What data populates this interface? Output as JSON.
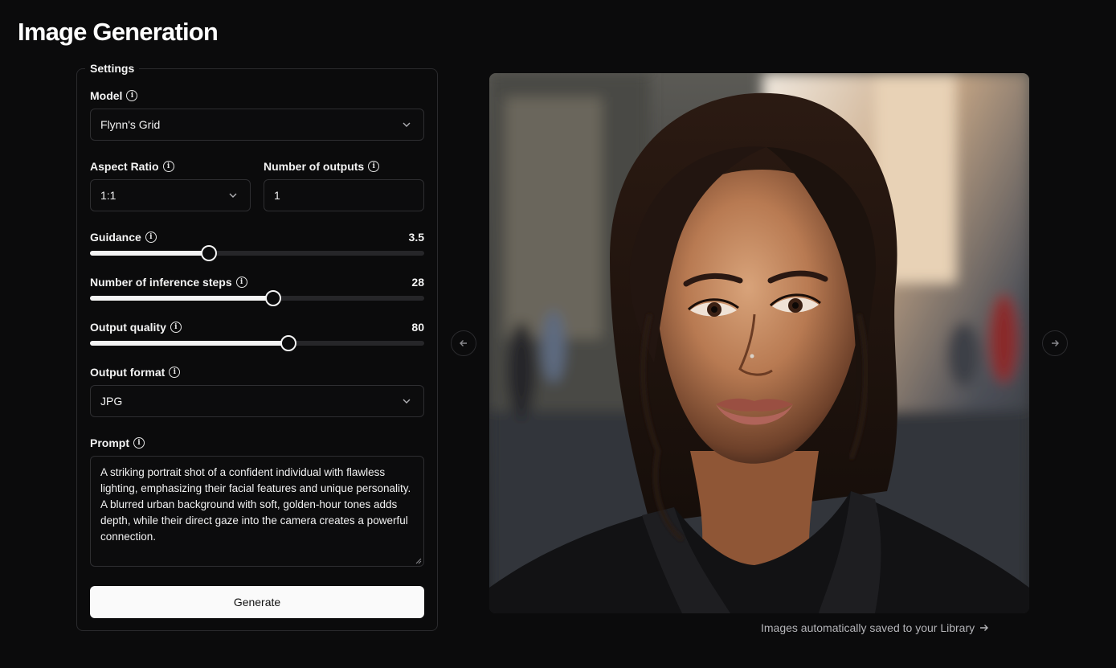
{
  "page": {
    "title": "Image Generation"
  },
  "settings": {
    "legend": "Settings",
    "model": {
      "label": "Model",
      "value": "Flynn's Grid"
    },
    "aspect_ratio": {
      "label": "Aspect Ratio",
      "value": "1:1"
    },
    "num_outputs": {
      "label": "Number of outputs",
      "value": "1"
    },
    "guidance": {
      "label": "Guidance",
      "value": "3.5",
      "fraction": 0.355
    },
    "inference_steps": {
      "label": "Number of inference steps",
      "value": "28",
      "fraction": 0.548
    },
    "output_quality": {
      "label": "Output quality",
      "value": "80",
      "fraction": 0.593
    },
    "output_format": {
      "label": "Output format",
      "value": "JPG"
    },
    "prompt": {
      "label": "Prompt",
      "value": "A striking portrait shot of a confident individual with flawless lighting, emphasizing their facial features and unique personality. A blurred urban background with soft, golden-hour tones adds depth, while their direct gaze into the camera creates a powerful connection."
    },
    "generate_label": "Generate"
  },
  "preview": {
    "footnote": "Images automatically saved to your Library",
    "prev_icon": "arrow-left-icon",
    "next_icon": "arrow-right-icon"
  },
  "colors": {
    "background": "#0b0b0c",
    "border": "#2a2a2d",
    "accent": "#fafafa"
  }
}
